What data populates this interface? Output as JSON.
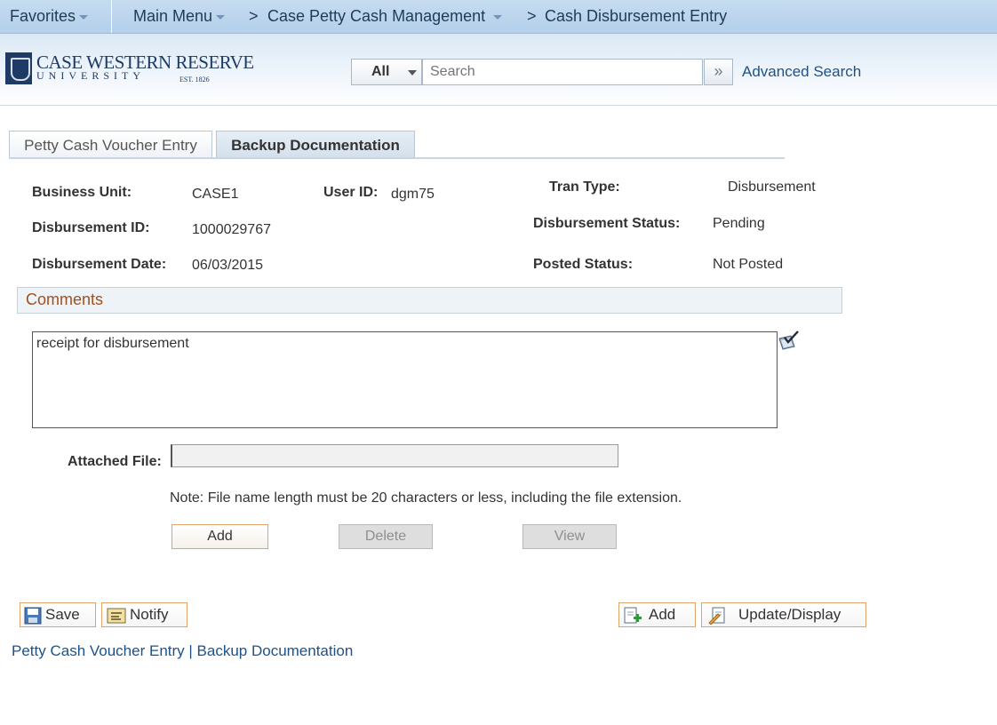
{
  "nav": {
    "favorites": "Favorites",
    "main_menu": "Main Menu",
    "breadcrumb_1": "Case Petty Cash Management",
    "breadcrumb_2": "Cash Disbursement Entry",
    "separator": ">"
  },
  "logo": {
    "line1": "CASE WESTERN RESERVE",
    "line2": "UNIVERSITY",
    "est": "EST. 1826"
  },
  "search": {
    "category": "All",
    "placeholder": "Search",
    "go_icon": "double-chevron-right-icon",
    "advanced": "Advanced Search"
  },
  "tabs": [
    {
      "label": "Petty Cash Voucher Entry",
      "active": false
    },
    {
      "label": "Backup Documentation",
      "active": true
    }
  ],
  "fields": {
    "business_unit_label": "Business Unit:",
    "business_unit": "CASE1",
    "user_id_label": "User ID:",
    "user_id": "dgm75",
    "tran_type_label": "Tran Type:",
    "tran_type": "Disbursement",
    "disbursement_id_label": "Disbursement ID:",
    "disbursement_id": "1000029767",
    "disbursement_status_label": "Disbursement Status:",
    "disbursement_status": "Pending",
    "disbursement_date_label": "Disbursement Date:",
    "disbursement_date": "06/03/2015",
    "posted_status_label": "Posted Status:",
    "posted_status": "Not Posted"
  },
  "comments": {
    "section_title": "Comments",
    "text": "receipt for disbursement",
    "spell_check_icon": "spell-check-icon"
  },
  "attachment": {
    "label": "Attached File:",
    "value": "",
    "note": "Note: File name length must be 20 characters or less, including the file extension.",
    "add_label": "Add",
    "delete_label": "Delete",
    "view_label": "View"
  },
  "toolbar": {
    "save": "Save",
    "notify": "Notify",
    "add": "Add",
    "update_display": "Update/Display"
  },
  "footer": {
    "link_1": "Petty Cash Voucher Entry",
    "sep": " | ",
    "link_2": "Backup Documentation"
  },
  "colors": {
    "nav_bg": "#c6dcf0",
    "link": "#1d5288",
    "comments_title": "#a0511f",
    "button_border": "#e0a46a"
  }
}
